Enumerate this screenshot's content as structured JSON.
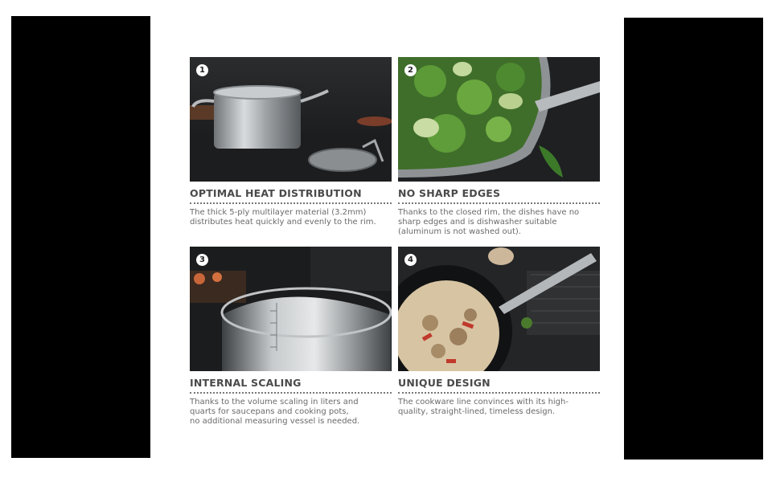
{
  "features": [
    {
      "number": "1",
      "title": "OPTIMAL HEAT DISTRIBUTION",
      "description": "The thick 5-ply multilayer material (3.2mm)\ndistributes heat quickly and evenly to the rim."
    },
    {
      "number": "2",
      "title": "NO SHARP EDGES",
      "description": "Thanks to the closed rim, the dishes have no\nsharp edges and is dishwasher suitable\n(aluminum is not washed out)."
    },
    {
      "number": "3",
      "title": "INTERNAL SCALING",
      "description": "Thanks to the volume scaling in liters and\nquarts for saucepans and cooking pots,\nno additional measuring vessel is needed."
    },
    {
      "number": "4",
      "title": "UNIQUE DESIGN",
      "description": "The cookware line convinces with its high-\nquality, straight-lined, timeless design."
    }
  ]
}
